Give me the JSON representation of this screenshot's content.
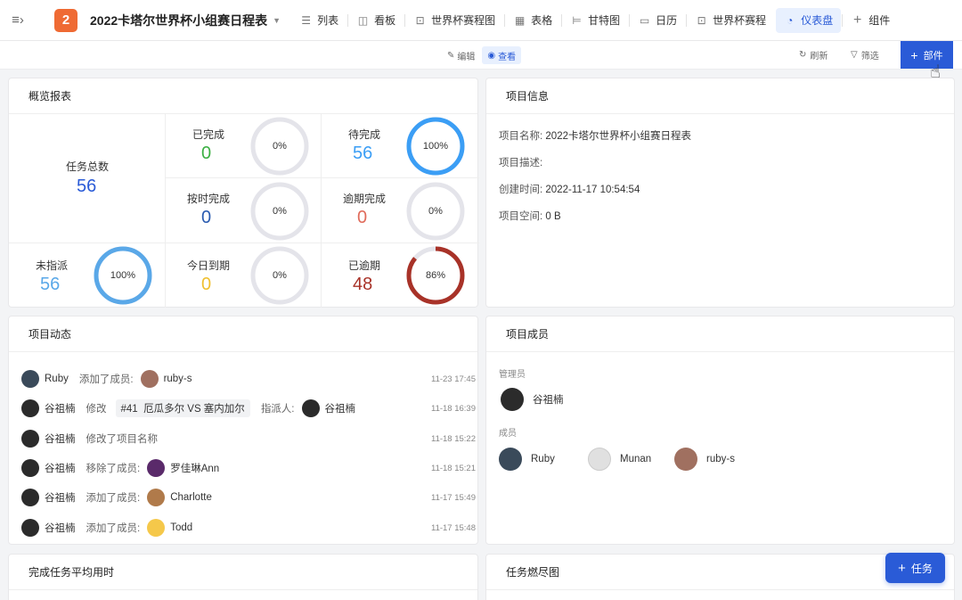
{
  "header": {
    "badge": "2",
    "title": "2022卡塔尔世界杯小组赛日程表",
    "tabs": [
      {
        "icon": "list-icon",
        "glyph": "☰",
        "label": "列表"
      },
      {
        "icon": "kanban-icon",
        "glyph": "◫",
        "label": "看板"
      },
      {
        "icon": "chart-icon",
        "glyph": "⊡",
        "label": "世界杯赛程图"
      },
      {
        "icon": "table-icon",
        "glyph": "▦",
        "label": "表格"
      },
      {
        "icon": "gantt-icon",
        "glyph": "⊨",
        "label": "甘特图"
      },
      {
        "icon": "calendar-icon",
        "glyph": "▭",
        "label": "日历"
      },
      {
        "icon": "chart-icon",
        "glyph": "⊡",
        "label": "世界杯赛程"
      },
      {
        "icon": "dashboard-icon",
        "glyph": "◔",
        "label": "仪表盘"
      },
      {
        "icon": "plus-icon",
        "glyph": "+",
        "label": "组件"
      }
    ]
  },
  "toolbar": {
    "edit": "编辑",
    "view": "查看",
    "refresh": "刷新",
    "filter": "筛选",
    "add_widget": "部件"
  },
  "overview": {
    "title": "概览报表",
    "total_label": "任务总数",
    "total_value": "56",
    "stats": [
      {
        "label": "已完成",
        "value": "0",
        "pct": "0%",
        "ratio": 0,
        "color": "#3cb043"
      },
      {
        "label": "待完成",
        "value": "56",
        "pct": "100%",
        "ratio": 1,
        "color": "#3b9ef5"
      },
      {
        "label": "按时完成",
        "value": "0",
        "pct": "0%",
        "ratio": 0,
        "color": "#2a5bb0"
      },
      {
        "label": "逾期完成",
        "value": "0",
        "pct": "0%",
        "ratio": 0,
        "color": "#e06b5b"
      },
      {
        "label": "未指派",
        "value": "56",
        "pct": "100%",
        "ratio": 1,
        "color": "#5aa8e8"
      },
      {
        "label": "今日到期",
        "value": "0",
        "pct": "0%",
        "ratio": 0,
        "color": "#f0c030"
      },
      {
        "label": "已逾期",
        "value": "48",
        "pct": "86%",
        "ratio": 0.86,
        "color": "#a83228"
      }
    ]
  },
  "info": {
    "title": "项目信息",
    "rows": [
      {
        "key": "项目名称:",
        "value": "2022卡塔尔世界杯小组赛日程表"
      },
      {
        "key": "项目描述:",
        "value": ""
      },
      {
        "key": "创建时间:",
        "value": "2022-11-17 10:54:54"
      },
      {
        "key": "项目空间:",
        "value": "0 B"
      }
    ]
  },
  "activity": {
    "title": "项目动态",
    "rows": [
      {
        "user": "Ruby",
        "verb": "添加了成员:",
        "tag": "",
        "target": "ruby-s",
        "extra_label": "",
        "extra_value": "",
        "time": "11-23 17:45"
      },
      {
        "user": "谷祖楠",
        "verb": "修改",
        "tag": "#41",
        "target": "厄瓜多尔 VS 塞内加尔",
        "extra_label": "指派人:",
        "extra_value": "谷祖楠",
        "time": "11-18 16:39"
      },
      {
        "user": "谷祖楠",
        "verb": "修改了项目名称",
        "tag": "",
        "target": "",
        "extra_label": "",
        "extra_value": "",
        "time": "11-18 15:22"
      },
      {
        "user": "谷祖楠",
        "verb": "移除了成员:",
        "tag": "",
        "target": "罗佳琳Ann",
        "extra_label": "",
        "extra_value": "",
        "time": "11-18 15:21"
      },
      {
        "user": "谷祖楠",
        "verb": "添加了成员:",
        "tag": "",
        "target": "Charlotte",
        "extra_label": "",
        "extra_value": "",
        "time": "11-17 15:49"
      },
      {
        "user": "谷祖楠",
        "verb": "添加了成员:",
        "tag": "",
        "target": "Todd",
        "extra_label": "",
        "extra_value": "",
        "time": "11-17 15:48"
      }
    ]
  },
  "members": {
    "title": "项目成员",
    "admin_label": "管理员",
    "admin": "谷祖楠",
    "member_label": "成员",
    "list": [
      "Ruby",
      "Munan",
      "ruby-s"
    ]
  },
  "bottom": {
    "avg_title": "完成任务平均用时",
    "burn_title": "任务燃尽图"
  },
  "fab": {
    "label": "任务"
  }
}
